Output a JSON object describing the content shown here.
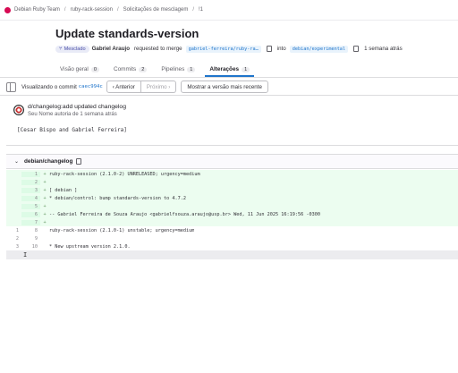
{
  "breadcrumb": {
    "items": [
      "Debian Ruby Team",
      "ruby-rack-session",
      "Solicitações de mesclagem",
      "!1"
    ]
  },
  "mr": {
    "title": "Update standards-version",
    "status": "Mesclado",
    "author": "Gabriel Araujo",
    "requested_text": "requested to merge",
    "source_branch": "gabriel-ferreira/ruby-ra…",
    "into_text": "into",
    "target_branch": "debian/experimental",
    "time": "1 semana atrás"
  },
  "tabs": [
    {
      "label": "Visão geral",
      "count": "0"
    },
    {
      "label": "Commits",
      "count": "2"
    },
    {
      "label": "Pipelines",
      "count": "1"
    },
    {
      "label": "Alterações",
      "count": "1"
    }
  ],
  "commit_bar": {
    "viewing_label": "Visualizando o commit",
    "sha": "caec994c",
    "prev_label": "‹  Anterior",
    "next_label": "Próximo  ›",
    "full_label": "Mostrar a versão mais recente"
  },
  "commit": {
    "message": "d/changelog:add updated changelog",
    "byline": "Seu Nome autoria de 1 semana atrás",
    "body": "[Cesar Bispo and Gabriel Ferreira]"
  },
  "file": {
    "name": "debian/changelog"
  },
  "diff_lines": [
    {
      "type": "added",
      "old": "",
      "new": "1",
      "sign": "+",
      "code": "ruby-rack-session (2.1.0-2) UNRELEASED; urgency=medium"
    },
    {
      "type": "added",
      "old": "",
      "new": "2",
      "sign": "+",
      "code": ""
    },
    {
      "type": "added",
      "old": "",
      "new": "3",
      "sign": "+",
      "code": "  [ debian ]"
    },
    {
      "type": "added",
      "old": "",
      "new": "4",
      "sign": "+",
      "code": "  * debian/control: bump standards-version to 4.7.2"
    },
    {
      "type": "added",
      "old": "",
      "new": "5",
      "sign": "+",
      "code": ""
    },
    {
      "type": "added",
      "old": "",
      "new": "6",
      "sign": "+",
      "code": " -- Gabriel Ferreira de Souza Araujo <gabrielfsouza.araujo@usp.br>  Wed, 11 Jun 2025 16:19:56 -0300"
    },
    {
      "type": "added",
      "old": "",
      "new": "7",
      "sign": "+",
      "code": ""
    },
    {
      "type": "context",
      "old": "1",
      "new": "8",
      "sign": "",
      "code": "ruby-rack-session (2.1.0-1) unstable; urgency=medium"
    },
    {
      "type": "context",
      "old": "2",
      "new": "9",
      "sign": "",
      "code": ""
    },
    {
      "type": "context",
      "old": "3",
      "new": "10",
      "sign": "",
      "code": "  * New upstream version 2.1.0."
    }
  ],
  "colors": {
    "accent": "#1f75cb",
    "added_bg": "#ecfdf0",
    "merged_badge_bg": "#e9ebf7"
  }
}
